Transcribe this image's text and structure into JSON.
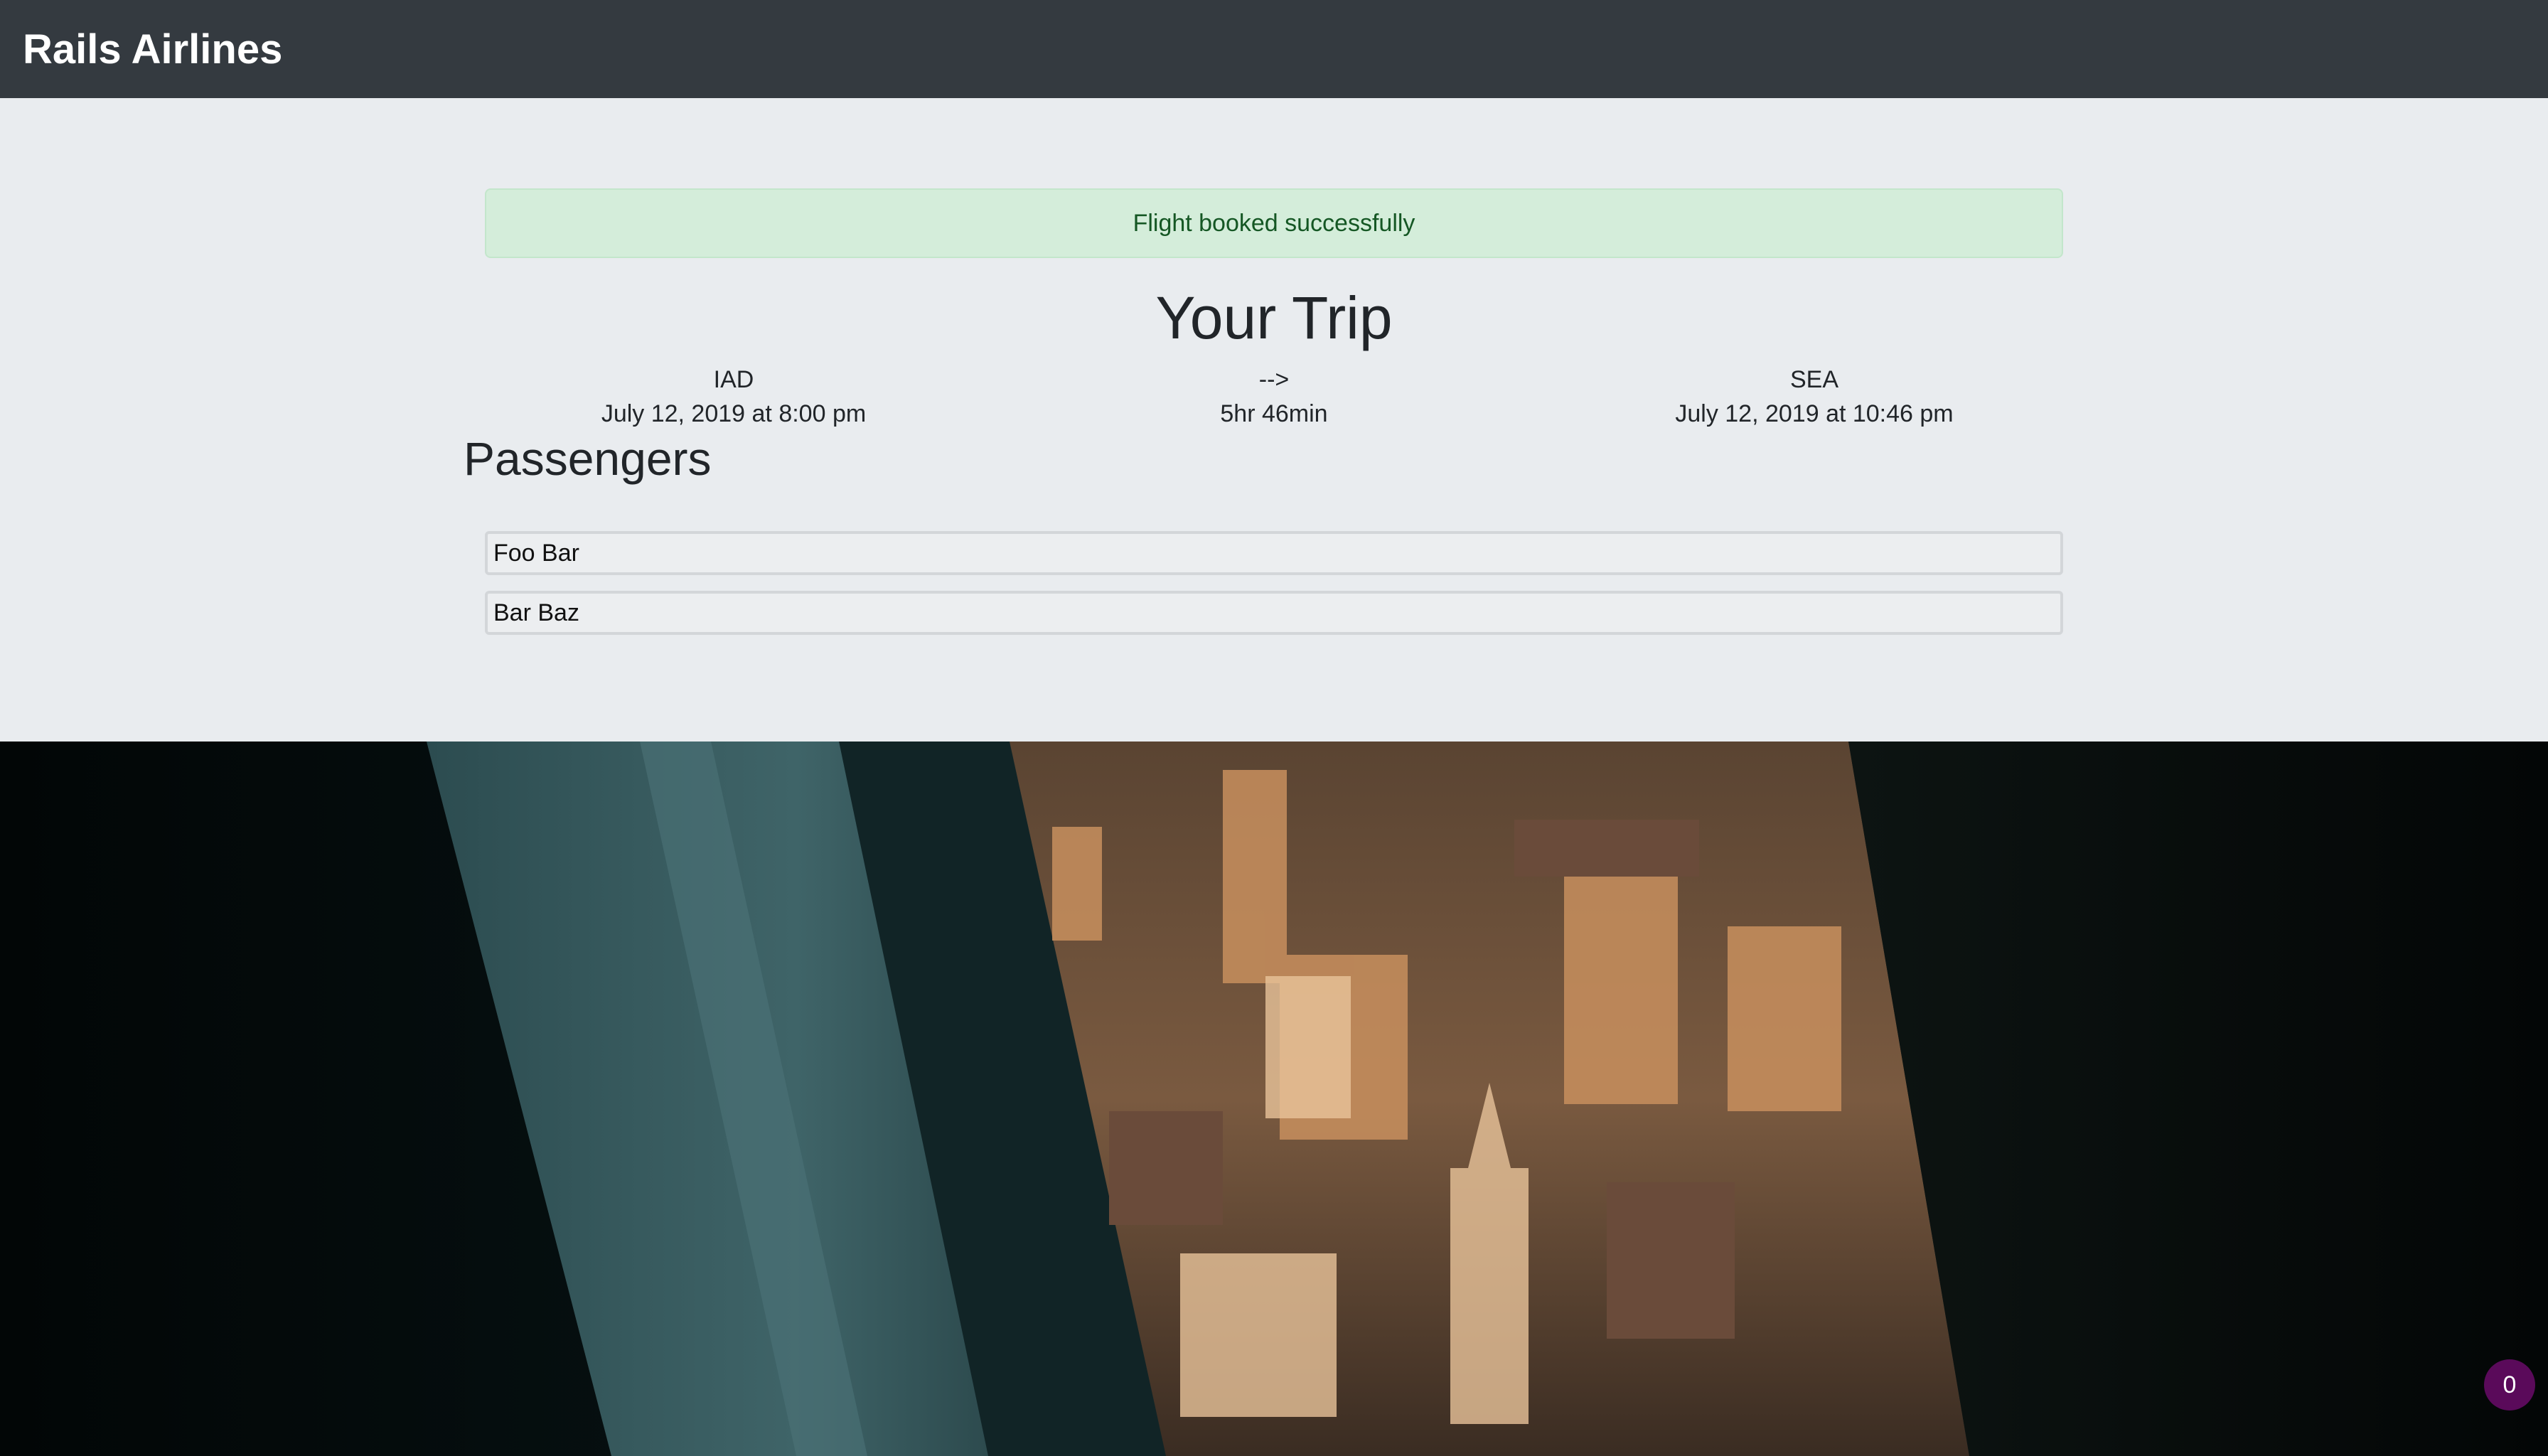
{
  "navbar": {
    "brand": "Rails Airlines"
  },
  "alert": {
    "message": "Flight booked successfully"
  },
  "trip": {
    "title": "Your Trip",
    "origin": {
      "code": "IAD",
      "departure": "July 12, 2019 at 8:00 pm"
    },
    "arrow": "-->",
    "duration": "5hr 46min",
    "destination": {
      "code": "SEA",
      "arrival": "July 12, 2019 at 10:46 pm"
    }
  },
  "passengers": {
    "title": "Passengers",
    "list": [
      "Foo Bar",
      "Bar Baz"
    ]
  },
  "badge": {
    "count": "0"
  },
  "colors": {
    "navbar": "#343a40",
    "jumbotron": "#e9ecef",
    "alert_bg": "#d4edda",
    "alert_text": "#155724",
    "badge": "#5a0a5a"
  }
}
